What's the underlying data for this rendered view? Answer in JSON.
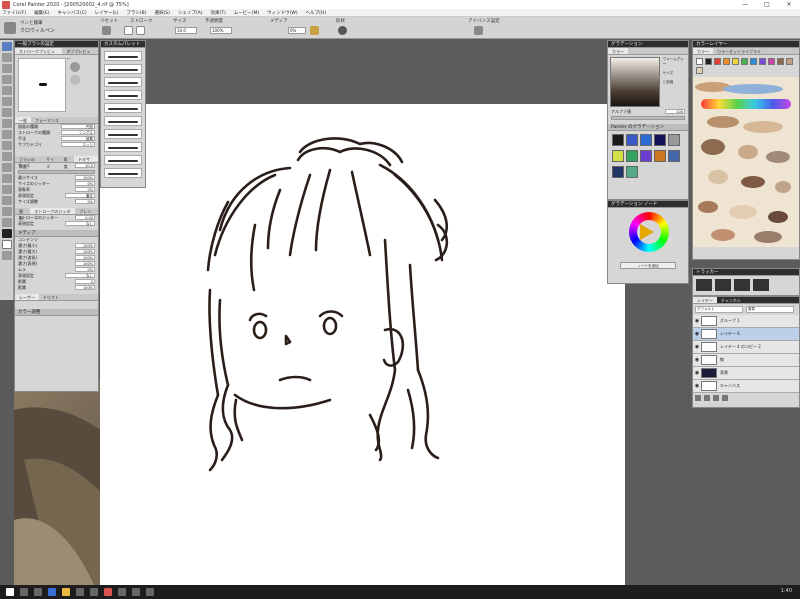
{
  "window": {
    "title": "Corel Painter 2020 - [200520002_4.rif @ 75%]",
    "controls": [
      "—",
      "□",
      "✕"
    ]
  },
  "menu": [
    "ファイル(F)",
    "編集(E)",
    "キャンバス(C)",
    "レイヤー(L)",
    "ブラシ(B)",
    "選択(S)",
    "シェイプ(A)",
    "効果(T)",
    "ムービー(M)",
    "ウィンドウ(W)",
    "ヘルプ(H)"
  ],
  "propbar": {
    "brush_category": "ペンと銭筆",
    "brush_variant": "クロウィルペン",
    "reset": "リセット",
    "stroke": "ストローク",
    "size_label": "サイズ",
    "size_value": "10.0",
    "opacity_label": "不透明度",
    "opacity_value": "100%",
    "media_label": "メディア",
    "grain_value": "0%",
    "shape_label": "形状",
    "advanced": "アドバンス設定"
  },
  "brush_panel": {
    "title": "一般ブラシの設定",
    "tabs": [
      "ストロークプレビュー",
      "ダブプレビュー"
    ],
    "general_tabs": [
      "一般",
      "フォーマンス"
    ],
    "rows": [
      {
        "label": "描画の種類",
        "value": "円形"
      },
      {
        "label": "ストロークの種類",
        "value": "シングル"
      },
      {
        "label": "手法",
        "value": "被覆"
      },
      {
        "label": "サブカテゴリ",
        "value": "エッジ"
      }
    ],
    "size_tabs": [
      "ブラシの精度",
      "サイズ",
      "角度",
      "ドキサイズ"
    ],
    "size_rows": [
      {
        "label": "サイズ",
        "value": "10.0"
      },
      {
        "label": "最小サイズ",
        "value": "100%"
      },
      {
        "label": "サイズのジッター",
        "value": "0%"
      },
      {
        "label": "表象率",
        "value": "0%"
      },
      {
        "label": "表現設定",
        "value": "筆圧"
      },
      {
        "label": "サイズ調整",
        "value": "0%"
      }
    ],
    "stroke_tabs": [
      "間隔",
      "ストロークのジッター",
      "ブレンド"
    ],
    "stroke_rows": [
      {
        "label": "ストロークのジッター",
        "value": "0.00"
      },
      {
        "label": "表現設定",
        "value": "なし"
      }
    ],
    "media_title": "メディア",
    "media_rows": [
      {
        "label": "コンテンツ",
        "value": ""
      },
      {
        "label": "濃さ(最小)",
        "value": "100%"
      },
      {
        "label": "濃さ(最大)",
        "value": "100%"
      },
      {
        "label": "濃さ(波長)",
        "value": "100%"
      },
      {
        "label": "濃さ(表現)",
        "value": "100%"
      },
      {
        "label": "ムラ",
        "value": "0%"
      },
      {
        "label": "表現設定",
        "value": "なし"
      },
      {
        "label": "影響",
        "value": "0"
      },
      {
        "label": "影響",
        "value": "100%"
      }
    ],
    "bottom_tabs": [
      "レーザー",
      "ドリフト"
    ],
    "color_variance": "カラー調整"
  },
  "brush_variants": {
    "title": "カスタムパレット"
  },
  "gradient_panel": {
    "title": "グラデーション",
    "tab": "カラー",
    "label1": "ウォームグレー",
    "label2": "サイズ",
    "label3": "と色相",
    "opacity_label": "アルファ値",
    "opacity_value": "100",
    "library_title": "Painter のグラデーション",
    "colors": [
      "#1a1a1a",
      "#3a5bc7",
      "#2d6ad6",
      "#111155",
      "#999999",
      "#d4e04a",
      "#30a15e",
      "#6b3ed3",
      "#cc7722",
      "#4466aa",
      "#223366",
      "#56aa88"
    ]
  },
  "colorwheel_panel": {
    "title": "グラデーション ノード",
    "button": "ノードを追加"
  },
  "mixer_panel": {
    "title": "カラーレイヤー",
    "tabs": [
      "カラー",
      "カラーセットライブラリ"
    ]
  },
  "tracker_panel": {
    "title": "トラッカー"
  },
  "layers_panel": {
    "tabs": [
      "レイヤー",
      "チャンネル"
    ],
    "composite": "デフォルト",
    "method": "乗算",
    "layers": [
      {
        "name": "グループ 1",
        "selected": false,
        "dark": false
      },
      {
        "name": "レイヤー 6",
        "selected": true,
        "dark": false
      },
      {
        "name": "レイヤー 4 のコピー 2",
        "selected": false,
        "dark": false
      },
      {
        "name": "線",
        "selected": false,
        "dark": false
      },
      {
        "name": "背景",
        "selected": false,
        "dark": true
      },
      {
        "name": "キャンバス",
        "selected": false,
        "dark": false
      }
    ]
  },
  "taskbar": {
    "time": "1:40"
  },
  "colors": {
    "ink": "#2a1e1a",
    "accent": "#5a7fbf",
    "title_dark": "#2e2e2e"
  }
}
